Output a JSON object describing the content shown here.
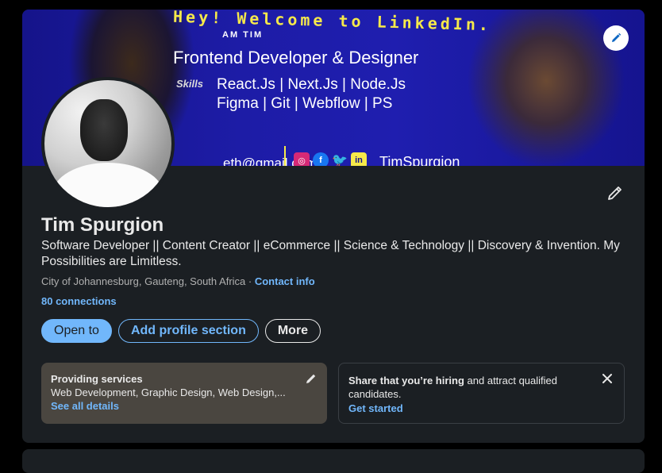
{
  "banner": {
    "greeting": "Hey! Welcome to LinkedIn.",
    "am": "AM TIM",
    "role": "Frontend Developer & Designer",
    "skills_tag": "Skills",
    "skills_line1": "React.Js | Next.Js | Node.Js",
    "skills_line2": "Figma | Git | Webflow | PS",
    "email_fragment": "eth@gmail.com",
    "handle": "TimSpurgion",
    "social_icons": [
      "instagram-icon",
      "facebook-icon",
      "twitter-icon",
      "linkedin-icon"
    ]
  },
  "profile": {
    "name": "Tim Spurgion",
    "headline": "Software Developer || Content Creator || eCommerce || Science & Technology || Discovery & Invention. My Possibilities are Limitless.",
    "location": "City of Johannesburg, Gauteng, South Africa",
    "separator": " · ",
    "contact_info": "Contact info",
    "connections": "80 connections"
  },
  "actions": {
    "open_to": "Open to",
    "add_section": "Add profile section",
    "more": "More"
  },
  "services_card": {
    "title": "Providing services",
    "description": "Web Development, Graphic Design, Web Design,...",
    "link": "See all details"
  },
  "hiring_card": {
    "bold": "Share that you’re hiring",
    "rest": " and attract qualified candidates.",
    "link": "Get started"
  },
  "colors": {
    "page_bg": "#000000",
    "card_bg": "#1b1f23",
    "accent": "#71b7fb",
    "banner_yellow": "#f6e94a",
    "services_bg": "#4a4640"
  }
}
